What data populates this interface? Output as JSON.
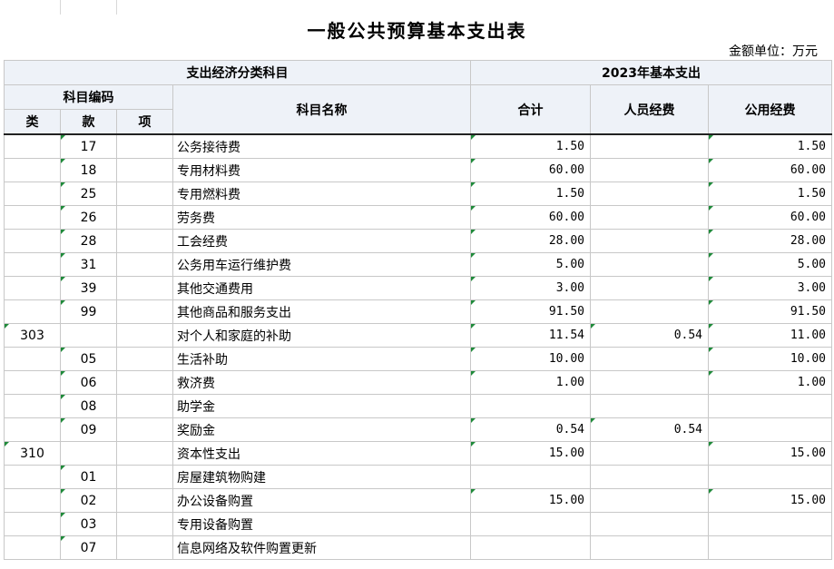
{
  "title": "一般公共预算基本支出表",
  "unit": "金额单位：万元",
  "header": {
    "group_left": "支出经济分类科目",
    "group_right": "2023年基本支出",
    "code_group": "科目编码",
    "col_lei": "类",
    "col_kuan": "款",
    "col_xiang": "项",
    "col_name": "科目名称",
    "col_total": "合计",
    "col_personnel": "人员经费",
    "col_public": "公用经费"
  },
  "rows": [
    {
      "lei": "",
      "kuan": "17",
      "xiang": "",
      "name": "公务接待费",
      "total": "1.50",
      "personnel": "",
      "public": "1.50"
    },
    {
      "lei": "",
      "kuan": "18",
      "xiang": "",
      "name": "专用材料费",
      "total": "60.00",
      "personnel": "",
      "public": "60.00"
    },
    {
      "lei": "",
      "kuan": "25",
      "xiang": "",
      "name": "专用燃料费",
      "total": "1.50",
      "personnel": "",
      "public": "1.50"
    },
    {
      "lei": "",
      "kuan": "26",
      "xiang": "",
      "name": "劳务费",
      "total": "60.00",
      "personnel": "",
      "public": "60.00"
    },
    {
      "lei": "",
      "kuan": "28",
      "xiang": "",
      "name": "工会经费",
      "total": "28.00",
      "personnel": "",
      "public": "28.00"
    },
    {
      "lei": "",
      "kuan": "31",
      "xiang": "",
      "name": "公务用车运行维护费",
      "total": "5.00",
      "personnel": "",
      "public": "5.00"
    },
    {
      "lei": "",
      "kuan": "39",
      "xiang": "",
      "name": "其他交通费用",
      "total": "3.00",
      "personnel": "",
      "public": "3.00"
    },
    {
      "lei": "",
      "kuan": "99",
      "xiang": "",
      "name": "其他商品和服务支出",
      "total": "91.50",
      "personnel": "",
      "public": "91.50"
    },
    {
      "lei": "303",
      "kuan": "",
      "xiang": "",
      "name": "对个人和家庭的补助",
      "total": "11.54",
      "personnel": "0.54",
      "public": "11.00"
    },
    {
      "lei": "",
      "kuan": "05",
      "xiang": "",
      "name": "生活补助",
      "total": "10.00",
      "personnel": "",
      "public": "10.00"
    },
    {
      "lei": "",
      "kuan": "06",
      "xiang": "",
      "name": "救济费",
      "total": "1.00",
      "personnel": "",
      "public": "1.00"
    },
    {
      "lei": "",
      "kuan": "08",
      "xiang": "",
      "name": "助学金",
      "total": "",
      "personnel": "",
      "public": ""
    },
    {
      "lei": "",
      "kuan": "09",
      "xiang": "",
      "name": "奖励金",
      "total": "0.54",
      "personnel": "0.54",
      "public": ""
    },
    {
      "lei": "310",
      "kuan": "",
      "xiang": "",
      "name": "资本性支出",
      "total": "15.00",
      "personnel": "",
      "public": "15.00"
    },
    {
      "lei": "",
      "kuan": "01",
      "xiang": "",
      "name": "房屋建筑物购建",
      "total": "",
      "personnel": "",
      "public": ""
    },
    {
      "lei": "",
      "kuan": "02",
      "xiang": "",
      "name": "办公设备购置",
      "total": "15.00",
      "personnel": "",
      "public": "15.00"
    },
    {
      "lei": "",
      "kuan": "03",
      "xiang": "",
      "name": "专用设备购置",
      "total": "",
      "personnel": "",
      "public": ""
    },
    {
      "lei": "",
      "kuan": "07",
      "xiang": "",
      "name": "信息网络及软件购置更新",
      "total": "",
      "personnel": "",
      "public": ""
    }
  ],
  "colors": {
    "header_bg": "#eef2f8",
    "grid": "#c8c8c8",
    "cell_marker": "#1f8a3a"
  }
}
